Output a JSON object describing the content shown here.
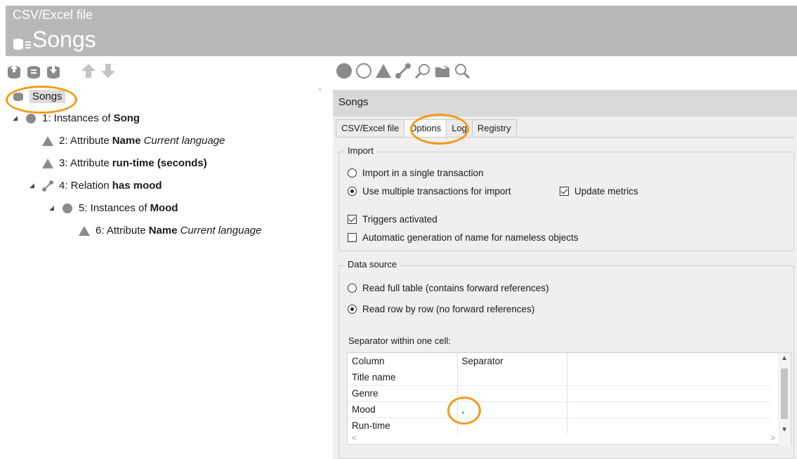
{
  "header": {
    "subtitle": "CSV/Excel file",
    "title": "Songs"
  },
  "toolbar": {
    "left_icons": [
      "import-icon",
      "export-icon",
      "download-icon",
      "move-up-icon",
      "move-down-icon"
    ],
    "right_icons": [
      "object-icon",
      "type-icon",
      "attribute-icon",
      "relation-icon",
      "search-icon",
      "folder-icon",
      "query-icon"
    ]
  },
  "tree": {
    "root": "Songs",
    "nodes": [
      {
        "prefix": "1: Instances of",
        "bold": "Song",
        "italic": ""
      },
      {
        "prefix": "2: Attribute",
        "bold": "Name",
        "italic": "Current language"
      },
      {
        "prefix": "3: Attribute",
        "bold": "run-time (seconds)",
        "italic": ""
      },
      {
        "prefix": "4: Relation",
        "bold": "has mood",
        "italic": ""
      },
      {
        "prefix": "5: Instances of",
        "bold": "Mood",
        "italic": ""
      },
      {
        "prefix": "6: Attribute",
        "bold": "Name",
        "italic": "Current language"
      }
    ]
  },
  "panel": {
    "title": "Songs",
    "tabs": [
      "CSV/Excel file",
      "Options",
      "Log",
      "Registry"
    ],
    "import": {
      "title": "Import",
      "single": "Import in a single transaction",
      "multiple": "Use multiple transactions for import",
      "update_metrics": "Update metrics",
      "triggers": "Triggers activated",
      "autoname": "Automatic generation of name for nameless objects"
    },
    "datasource": {
      "title": "Data source",
      "full": "Read full table (contains forward references)",
      "row": "Read row by row (no forward references)"
    },
    "separator_label": "Separator within one cell:",
    "table": {
      "headers": [
        "Column",
        "Separator"
      ],
      "rows": [
        {
          "column": "Title name",
          "separator": ""
        },
        {
          "column": "Genre",
          "separator": ""
        },
        {
          "column": "Mood",
          "separator": ","
        },
        {
          "column": "Run-time",
          "separator": ""
        }
      ]
    }
  },
  "colors": {
    "highlight": "#f49a1a",
    "header_bg": "#b8b8b8",
    "icon_gray": "#8a8a8a"
  }
}
